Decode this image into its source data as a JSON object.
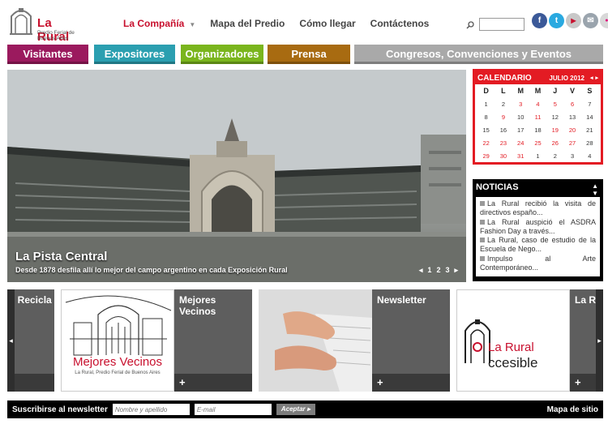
{
  "brand": {
    "name": "La Rural",
    "tagline": "Predio Ferial de Buenos Aires"
  },
  "nav": {
    "items": [
      {
        "label": "La Compañía",
        "active": true,
        "has_dropdown": true
      },
      {
        "label": "Mapa del Predio"
      },
      {
        "label": "Cómo llegar"
      },
      {
        "label": "Contáctenos"
      }
    ]
  },
  "search": {
    "placeholder": ""
  },
  "social": [
    {
      "icon": "facebook-icon",
      "glyph": "f",
      "color": "#3b5998"
    },
    {
      "icon": "twitter-icon",
      "glyph": "t",
      "color": "#2aa9e0"
    },
    {
      "icon": "youtube-icon",
      "glyph": "▶",
      "color": "#c8c8c8"
    },
    {
      "icon": "email-icon",
      "glyph": "✉",
      "color": "#9aa4ad"
    },
    {
      "icon": "flickr-icon",
      "glyph": "●●",
      "color": "#d8d8d8"
    }
  ],
  "categories": [
    {
      "label": "Visitantes",
      "color": "#9b1a5e"
    },
    {
      "label": "Expositores",
      "color": "#2b9fb0"
    },
    {
      "label": "Organizadores",
      "color": "#7ab51d"
    },
    {
      "label": "Prensa",
      "color": "#a86b11"
    },
    {
      "label": "Congresos, Convenciones y Eventos",
      "color": "#a9a9a9"
    }
  ],
  "hero": {
    "title": "La Pista Central",
    "subtitle": "Desde 1878 desfila allí lo mejor del campo argentino en cada Exposición Rural",
    "pages": [
      "1",
      "2",
      "3"
    ],
    "prev": "◂",
    "next": "▸"
  },
  "calendar": {
    "title": "CALENDARIO",
    "month": "JULIO 2012",
    "prev": "◂",
    "next": "▸",
    "weekdays": [
      "D",
      "L",
      "M",
      "M",
      "J",
      "V",
      "S"
    ],
    "weeks": [
      [
        {
          "d": "1"
        },
        {
          "d": "2"
        },
        {
          "d": "3",
          "red": true
        },
        {
          "d": "4",
          "red": true
        },
        {
          "d": "5",
          "red": true
        },
        {
          "d": "6",
          "red": true
        },
        {
          "d": "7"
        }
      ],
      [
        {
          "d": "8"
        },
        {
          "d": "9",
          "red": true
        },
        {
          "d": "10"
        },
        {
          "d": "11",
          "red": true
        },
        {
          "d": "12"
        },
        {
          "d": "13"
        },
        {
          "d": "14"
        }
      ],
      [
        {
          "d": "15"
        },
        {
          "d": "16"
        },
        {
          "d": "17"
        },
        {
          "d": "18"
        },
        {
          "d": "19",
          "red": true
        },
        {
          "d": "20",
          "red": true
        },
        {
          "d": "21"
        }
      ],
      [
        {
          "d": "22",
          "red": true
        },
        {
          "d": "23",
          "red": true
        },
        {
          "d": "24",
          "red": true
        },
        {
          "d": "25",
          "red": true
        },
        {
          "d": "26",
          "red": true
        },
        {
          "d": "27",
          "red": true
        },
        {
          "d": "28"
        }
      ],
      [
        {
          "d": "29",
          "red": true
        },
        {
          "d": "30",
          "red": true
        },
        {
          "d": "31",
          "red": true
        },
        {
          "d": "1"
        },
        {
          "d": "2"
        },
        {
          "d": "3"
        },
        {
          "d": "4"
        }
      ]
    ]
  },
  "news": {
    "title": "NOTICIAS",
    "items": [
      "La Rural recibió la visita de directivos españo...",
      "La Rural auspició el ASDRA Fashion Day a través...",
      "La Rural, caso de estudio de la Escuela de Nego...",
      "Impulso al Arte Contemporáneo..."
    ]
  },
  "carousel": {
    "left_label": "l Recicla",
    "panels": [
      {
        "label": "Mejores Vecinos",
        "plus": "+",
        "thumb_text": "Mejores Vecinos",
        "thumb_sub": "La Rural, Predio Ferial de Buenos Aires"
      },
      {
        "label": "Newsletter",
        "plus": "+"
      },
      {
        "label": "La Ru",
        "plus": "+",
        "thumb_text": "La Rural",
        "thumb_text2": "ccesible"
      }
    ]
  },
  "footer": {
    "newsletter_label": "Suscribirse al newsletter",
    "name_placeholder": "Nombre y apellido",
    "email_placeholder": "E-mail",
    "submit_label": "Aceptar ▸",
    "sitemap": "Mapa de sitio"
  }
}
